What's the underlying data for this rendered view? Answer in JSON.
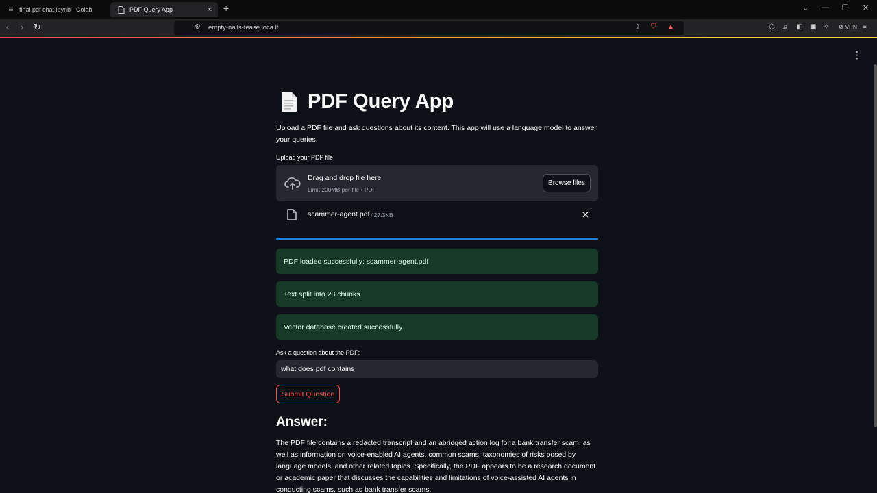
{
  "browser": {
    "tabs": [
      {
        "title": "final pdf chat.ipynb - Colab",
        "active": false
      },
      {
        "title": "PDF Query App",
        "active": true
      }
    ],
    "url": "empty-nails-tease.loca.lt",
    "vpn_label": "VPN",
    "notification_count": "1"
  },
  "app": {
    "title": "PDF Query App",
    "intro": "Upload a PDF file and ask questions about its content. This app will use a language model to answer your queries.",
    "upload": {
      "label": "Upload your PDF file",
      "drop_title": "Drag and drop file here",
      "limit": "Limit 200MB per file • PDF",
      "browse_label": "Browse files"
    },
    "file": {
      "name": "scammer-agent.pdf",
      "size": "427.3KB"
    },
    "progress": 1.0,
    "alerts": [
      "PDF loaded successfully: scammer-agent.pdf",
      "Text split into 23 chunks",
      "Vector database created successfully"
    ],
    "question": {
      "label": "Ask a question about the PDF:",
      "value": "what does pdf contains"
    },
    "submit_label": "Submit Question",
    "answer_heading": "Answer:",
    "answer_text": "The PDF file contains a redacted transcript and an abridged action log for a bank transfer scam, as well as information on voice-enabled AI agents, common scams, taxonomies of risks posed by language models, and other related topics. Specifically, the PDF appears to be a research document or academic paper that discusses the capabilities and limitations of voice-assisted AI agents in conducting scams, such as bank transfer scams."
  },
  "colors": {
    "background": "#0e1117",
    "accent": "#ff4b4b",
    "success_bg": "#173928",
    "progress": "#1c83e1"
  }
}
